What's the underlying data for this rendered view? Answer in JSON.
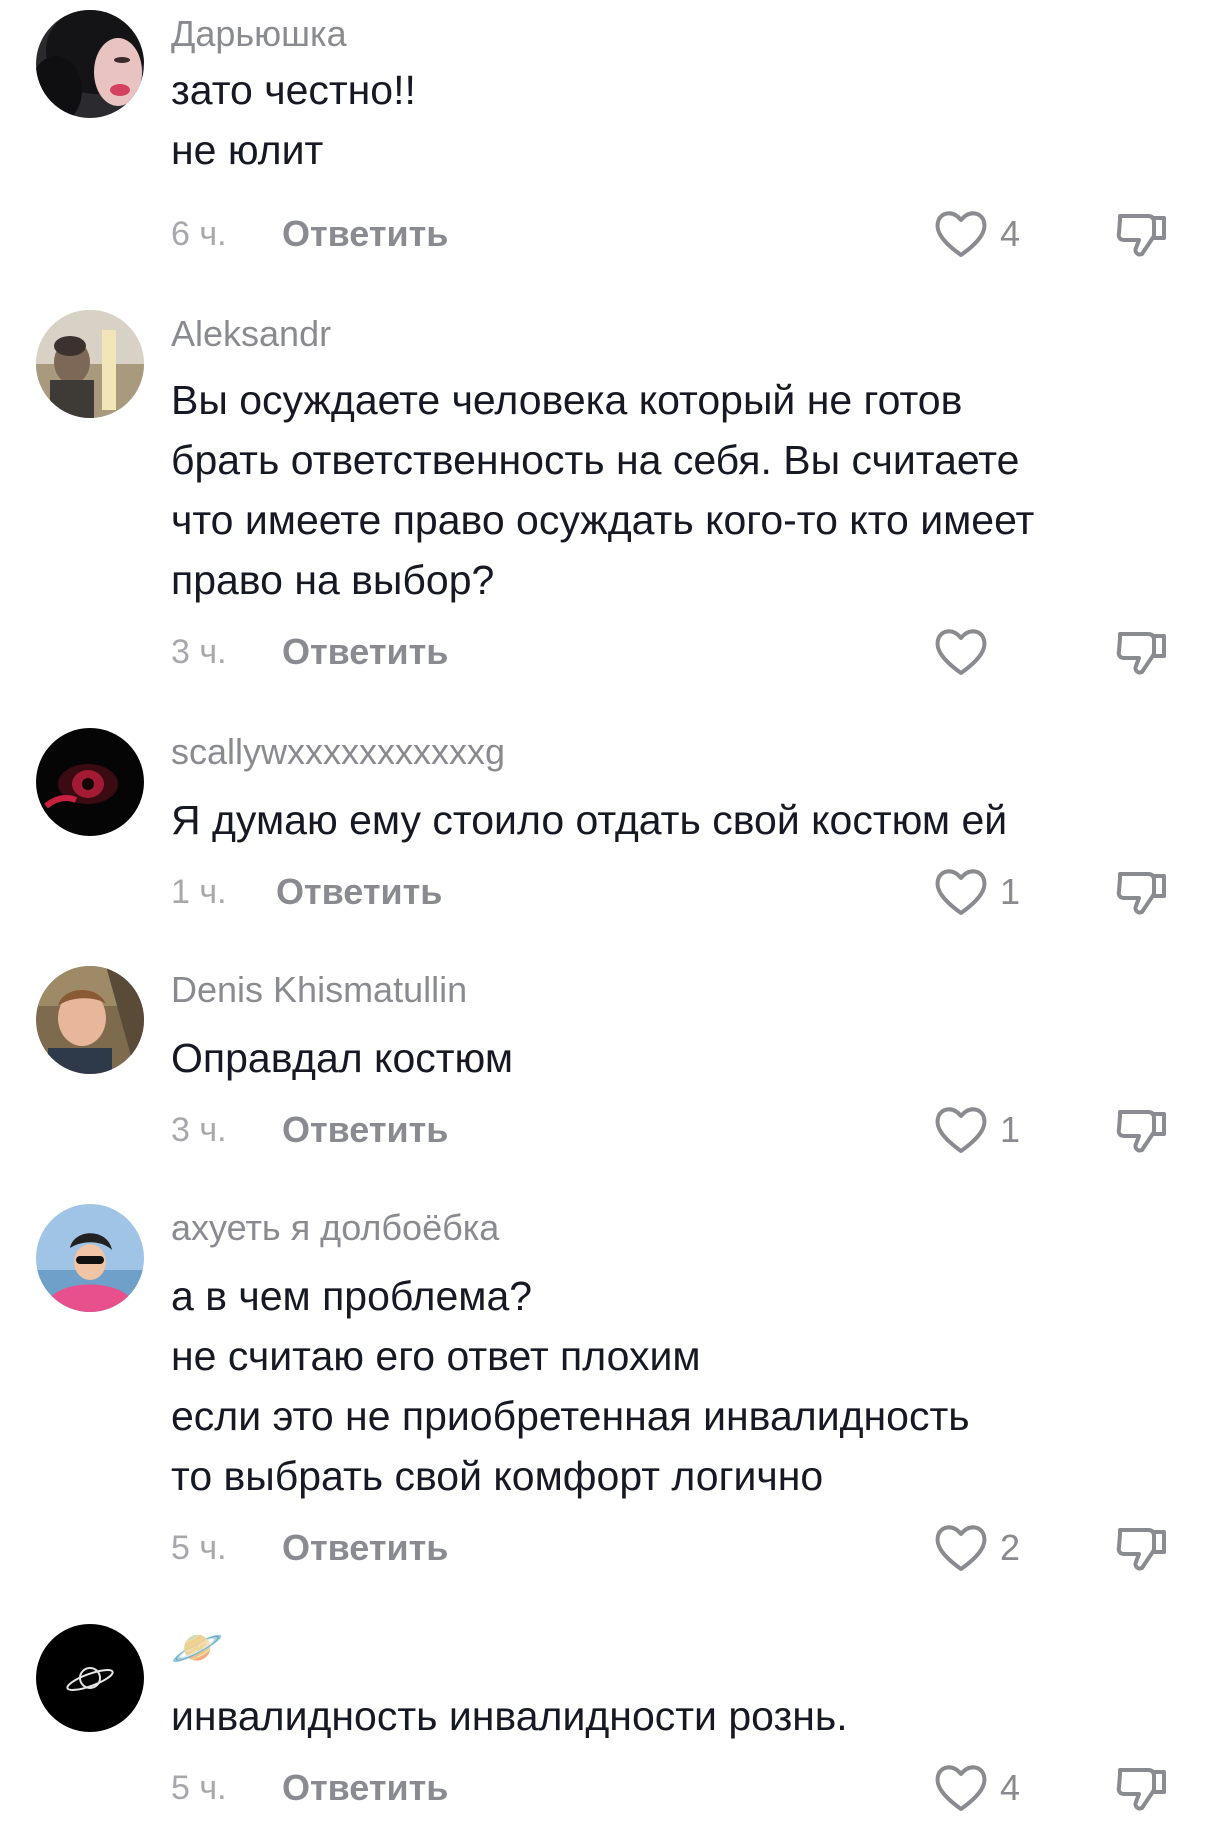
{
  "reply_label": "Ответить",
  "comments": [
    {
      "username": "Дарьюшка",
      "lines": [
        "зато честно!!",
        "не юлит"
      ],
      "time": "6 ч.",
      "likes": "4",
      "avatar": "avatar-dark-hair-pink-lips"
    },
    {
      "username": "Aleksandr",
      "lines": [
        "Вы осуждаете человека который не готов",
        "брать ответственность на себя. Вы считаете",
        "что имеете право осуждать кого-то кто имеет",
        "право на выбор?"
      ],
      "time": "3 ч.",
      "likes": "",
      "avatar": "avatar-man-sunset-lake"
    },
    {
      "username": "scallywxxxxxxxxxxxg",
      "lines": [
        "Я думаю ему стоило отдать свой костюм ей"
      ],
      "time": "1 ч.",
      "likes": "1",
      "avatar": "avatar-red-eye-dark"
    },
    {
      "username": "Denis Khismatullin",
      "lines": [
        "Оправдал костюм"
      ],
      "time": "3 ч.",
      "likes": "1",
      "avatar": "avatar-smiling-man-railway"
    },
    {
      "username": "ахуеть я долбоёбка",
      "lines": [
        "а в чем проблема?",
        "не считаю его ответ плохим",
        "если это не приобретенная инвалидность",
        "то выбрать свой комфорт логично"
      ],
      "time": "5 ч.",
      "likes": "2",
      "avatar": "avatar-girl-pink-sunglasses"
    },
    {
      "username": "🪐",
      "lines": [
        "инвалидность инвалидности рознь."
      ],
      "time": "5 ч.",
      "likes": "4",
      "avatar": "avatar-planet-black"
    }
  ]
}
